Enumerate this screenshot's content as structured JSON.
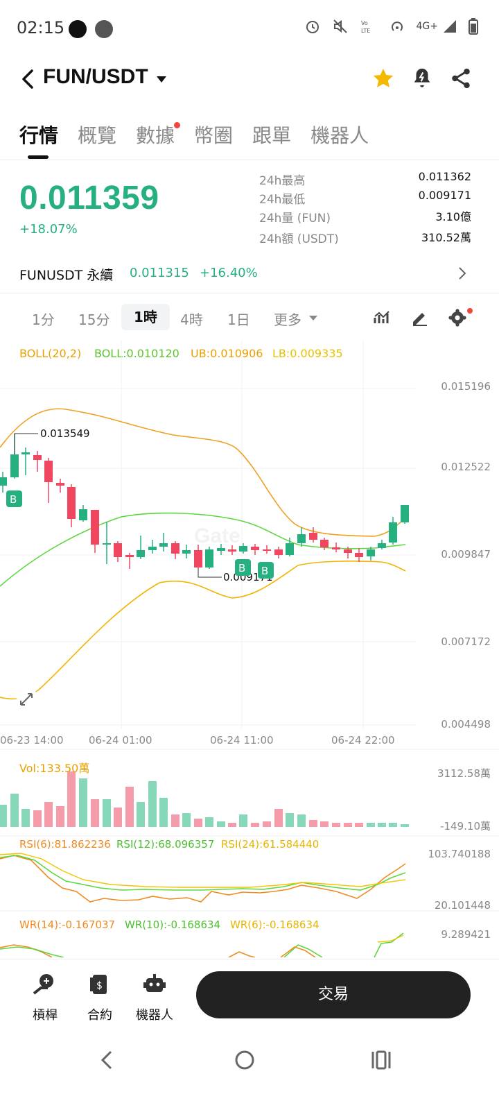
{
  "status_bar": {
    "time": "02:15",
    "network": "4G+"
  },
  "header": {
    "title": "FUN/USDT"
  },
  "tabs": [
    {
      "label": "行情"
    },
    {
      "label": "概覽"
    },
    {
      "label": "數據"
    },
    {
      "label": "幣圈"
    },
    {
      "label": "跟單"
    },
    {
      "label": "機器人"
    }
  ],
  "price": {
    "last": "0.011359",
    "change": "+18.07%"
  },
  "stats": [
    {
      "label": "24h最高",
      "value": "0.011362"
    },
    {
      "label": "24h最低",
      "value": "0.009171"
    },
    {
      "label": "24h量 (FUN)",
      "value": "3.10億"
    },
    {
      "label": "24h額 (USDT)",
      "value": "310.52萬"
    }
  ],
  "perp": {
    "name": "FUNUSDT 永續",
    "price": "0.011315",
    "change": "+16.40%"
  },
  "intervals": [
    {
      "label": "1分"
    },
    {
      "label": "15分"
    },
    {
      "label": "1時"
    },
    {
      "label": "4時"
    },
    {
      "label": "1日"
    },
    {
      "label": "更多"
    }
  ],
  "indicators": {
    "boll_params": "BOLL(20,2)",
    "boll": "BOLL:0.010120",
    "ub": "UB:0.010906",
    "lb": "LB:0.009335",
    "vol": "Vol:133.50萬",
    "rsi6": "RSI(6):81.862236",
    "rsi12": "RSI(12):68.096357",
    "rsi24": "RSI(24):61.584440",
    "wr14": "WR(14):-0.167037",
    "wr10": "WR(10):-0.168634",
    "wr6": "WR(6):-0.168634"
  },
  "chart_labels": {
    "y_main": [
      "0.015196",
      "0.012522",
      "0.009847",
      "0.007172",
      "0.004498"
    ],
    "y_vol": [
      "3112.58萬",
      "-149.10萬"
    ],
    "y_rsi": [
      "103.740188",
      "20.101448"
    ],
    "y_wr": [
      "9.289421"
    ],
    "x": [
      "06-23 14:00",
      "06-24 01:00",
      "06-24 11:00",
      "06-24 22:00"
    ],
    "high_marker": "0.013549",
    "low_marker": "0.009171",
    "buy_tag": "B"
  },
  "bottom_bar": [
    {
      "label": "槓桿"
    },
    {
      "label": "合約"
    },
    {
      "label": "機器人"
    }
  ],
  "trade_button": "交易",
  "colors": {
    "up": "#26b07f",
    "down": "#f0465f",
    "boll_mid": "#5dd640",
    "boll_band": "#f0a020"
  }
}
